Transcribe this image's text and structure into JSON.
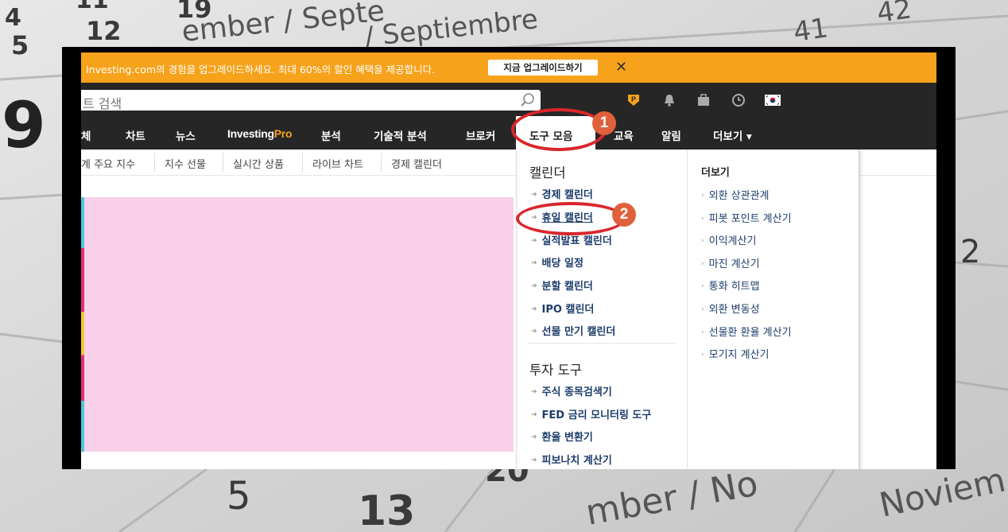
{
  "background": {
    "calendar_numbers": [
      "4",
      "11",
      "19",
      "5",
      "12",
      "9",
      "41",
      "42",
      "2",
      "5",
      "13",
      "20"
    ],
    "calendar_words": [
      "ember / Septe",
      "/ Septiembre",
      "mber / No",
      "Noviem"
    ]
  },
  "promo": {
    "message": "Investing.com의 경험을 업그레이드하세요. 최대 60%의 할인 혜택을 제공합니다.",
    "cta_label": "지금 업그레이드하기",
    "close_glyph": "✕"
  },
  "search": {
    "placeholder": "트 검색"
  },
  "nav": {
    "items": [
      "체",
      "차트",
      "뉴스",
      "분석",
      "기술적 분석",
      "브로커",
      "도구 모음",
      "교육",
      "알림",
      "더보기 ▾"
    ],
    "pro_prefix": "Investing",
    "pro_suffix": "Pro"
  },
  "subnav": {
    "items": [
      "계 주요 지수",
      "지수 선물",
      "실시간 상품",
      "라이브 차트",
      "경제 캘린더"
    ]
  },
  "dropdown": {
    "calendar_title": "캘린더",
    "calendar_links": [
      "경제 캘린더",
      "휴일 캘린더",
      "실적발표 캘린더",
      "배당 일정",
      "분할 캘린더",
      "IPO 캘린더",
      "선물 만기 캘린더"
    ],
    "tools_title": "투자 도구",
    "tools_links": [
      "주식 종목검색기",
      "FED 금리 모니터링 도구",
      "환율 변환기",
      "피보나치 계산기"
    ],
    "more_title": "더보기",
    "more_links": [
      "외환 상관관계",
      "피봇 포인트 계산기",
      "이익계산기",
      "마진 계산기",
      "통화 히트맵",
      "외환 변동성",
      "선물환 환율 계산기",
      "모기지 계산기"
    ]
  },
  "annotations": {
    "step1": "1",
    "step2": "2"
  },
  "colors": {
    "accent": "#f7a21b",
    "nav_bg": "#262626",
    "link": "#1d3c6b",
    "ring": "#d8262c",
    "badge": "#e0603b",
    "ad": "#f9d0ea"
  }
}
